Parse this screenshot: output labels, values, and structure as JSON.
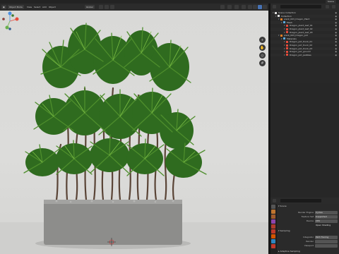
{
  "topbar": {
    "workspace": "Scene"
  },
  "viewport_header": {
    "mode": "Object Mode",
    "view": "View",
    "select": "Select",
    "add": "Add",
    "object": "Object",
    "orientation": "Global"
  },
  "outliner": {
    "title": "Scene Collection",
    "items": [
      {
        "label": "Scene Collection",
        "indent": 0,
        "icon_color": "#e0e0e0"
      },
      {
        "label": "Collection",
        "indent": 1,
        "icon_color": "#e0e0e0"
      },
      {
        "label": "plant_003_Dragon_Plant",
        "indent": 2,
        "icon_color": "#e67e22"
      },
      {
        "label": "Mesh",
        "indent": 3,
        "icon_color": "#5dade2"
      },
      {
        "label": "Dragon_plant_leaf_01",
        "indent": 4,
        "icon_color": "#e74c3c"
      },
      {
        "label": "Dragon_plant_leaf_02",
        "indent": 4,
        "icon_color": "#e74c3c"
      },
      {
        "label": "Dragon_plant_leaf_03",
        "indent": 4,
        "icon_color": "#e74c3c"
      },
      {
        "label": "plant_003_Dragon_pot",
        "indent": 2,
        "icon_color": "#e67e22"
      },
      {
        "label": "Materials",
        "indent": 3,
        "icon_color": "#5dade2"
      },
      {
        "label": "Dragon_pot_trunk_01",
        "indent": 4,
        "icon_color": "#e74c3c"
      },
      {
        "label": "Dragon_pot_trunk_02",
        "indent": 4,
        "icon_color": "#e74c3c"
      },
      {
        "label": "Dragon_pot_trunk_03",
        "indent": 4,
        "icon_color": "#e74c3c"
      },
      {
        "label": "Dragon_pot_ground",
        "indent": 4,
        "icon_color": "#e74c3c"
      },
      {
        "label": "Dragon_pot_pebbles",
        "indent": 4,
        "icon_color": "#e74c3c"
      }
    ]
  },
  "properties": {
    "section_scene": "Scene",
    "rows": [
      {
        "label": "Render Engine",
        "value": "Cycles"
      },
      {
        "label": "Feature Set",
        "value": "Supported"
      },
      {
        "label": "Device",
        "value": "CPU"
      },
      {
        "label": "",
        "value": "Open Shading Language"
      }
    ],
    "section_sampling": "Sampling",
    "rows2": [
      {
        "label": "Integrator",
        "value": "Path Tracing"
      },
      {
        "label": "Render",
        "value": ""
      },
      {
        "label": "Viewport",
        "value": ""
      }
    ],
    "section_denoise": "Adaptive Sampling"
  },
  "colors": {
    "accent": "#4772b3",
    "leaf_dark": "#2f6b1f",
    "leaf_light": "#5c9c34",
    "pot": "#8d8d8b"
  }
}
